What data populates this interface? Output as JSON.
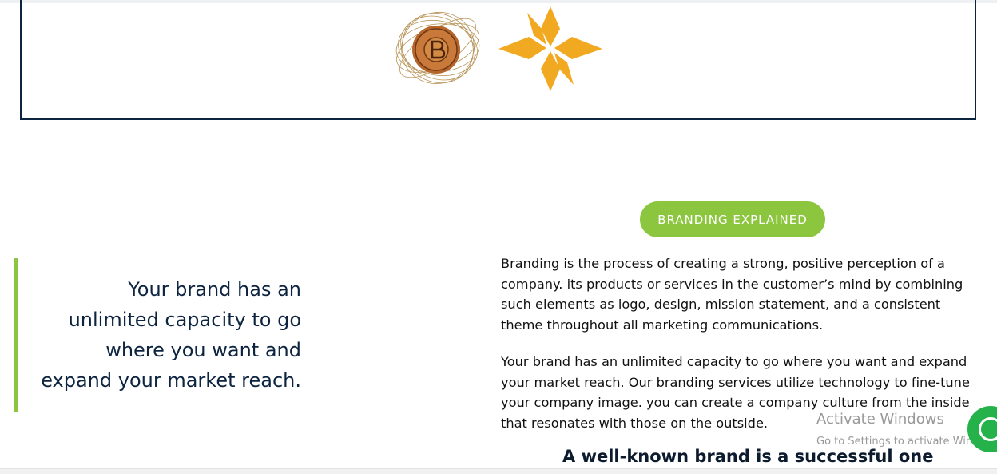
{
  "logos": [
    {
      "name": "coin-emblem-logo"
    },
    {
      "name": "orange-star-logo"
    }
  ],
  "section": {
    "pill_label": "BRANDING EXPLAINED",
    "quote": "Your brand has an unlimited capacity to go where you want and expand your market reach.",
    "paragraph1": "Branding is the process of creating a strong, positive perception of a company. its products or services in the customer’s mind by combining such elements as logo, design, mission statement, and a consistent theme throughout all marketing communications.",
    "paragraph2": "Your brand has an unlimited capacity to go where you want and expand your market reach. Our branding services utilize technology to fine-tune your company image. you can create a company culture from the inside that resonates with those on the outside.",
    "subheading": "A well-known brand is a successful one"
  },
  "overlay": {
    "activate_title": "Activate Windows",
    "activate_sub": "Go to Settings to activate Windows."
  },
  "colors": {
    "accent_green": "#8cc63f",
    "navy": "#0d2440",
    "star_orange": "#f2a922",
    "chat_green": "#25b24a"
  }
}
